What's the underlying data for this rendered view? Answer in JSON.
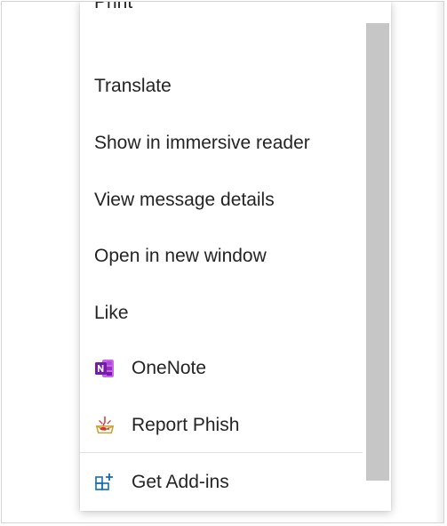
{
  "menu": {
    "items": [
      {
        "label": "Print",
        "icon": null
      },
      {
        "label": "Translate",
        "icon": null
      },
      {
        "label": "Show in immersive reader",
        "icon": null
      },
      {
        "label": "View message details",
        "icon": null
      },
      {
        "label": "Open in new window",
        "icon": null
      },
      {
        "label": "Like",
        "icon": null
      },
      {
        "label": "OneNote",
        "icon": "onenote-icon"
      },
      {
        "label": "Report Phish",
        "icon": "report-phish-icon"
      },
      {
        "label": "Get Add-ins",
        "icon": "add-ins-icon"
      }
    ]
  },
  "colors": {
    "highlight": "#ffff33",
    "onenote": "#7719aa",
    "addins": "#0f6cbd",
    "phish_red": "#d13438",
    "phish_gold": "#c9a227",
    "text": "#242424",
    "scrollbar_thumb": "#c6c6c6"
  }
}
